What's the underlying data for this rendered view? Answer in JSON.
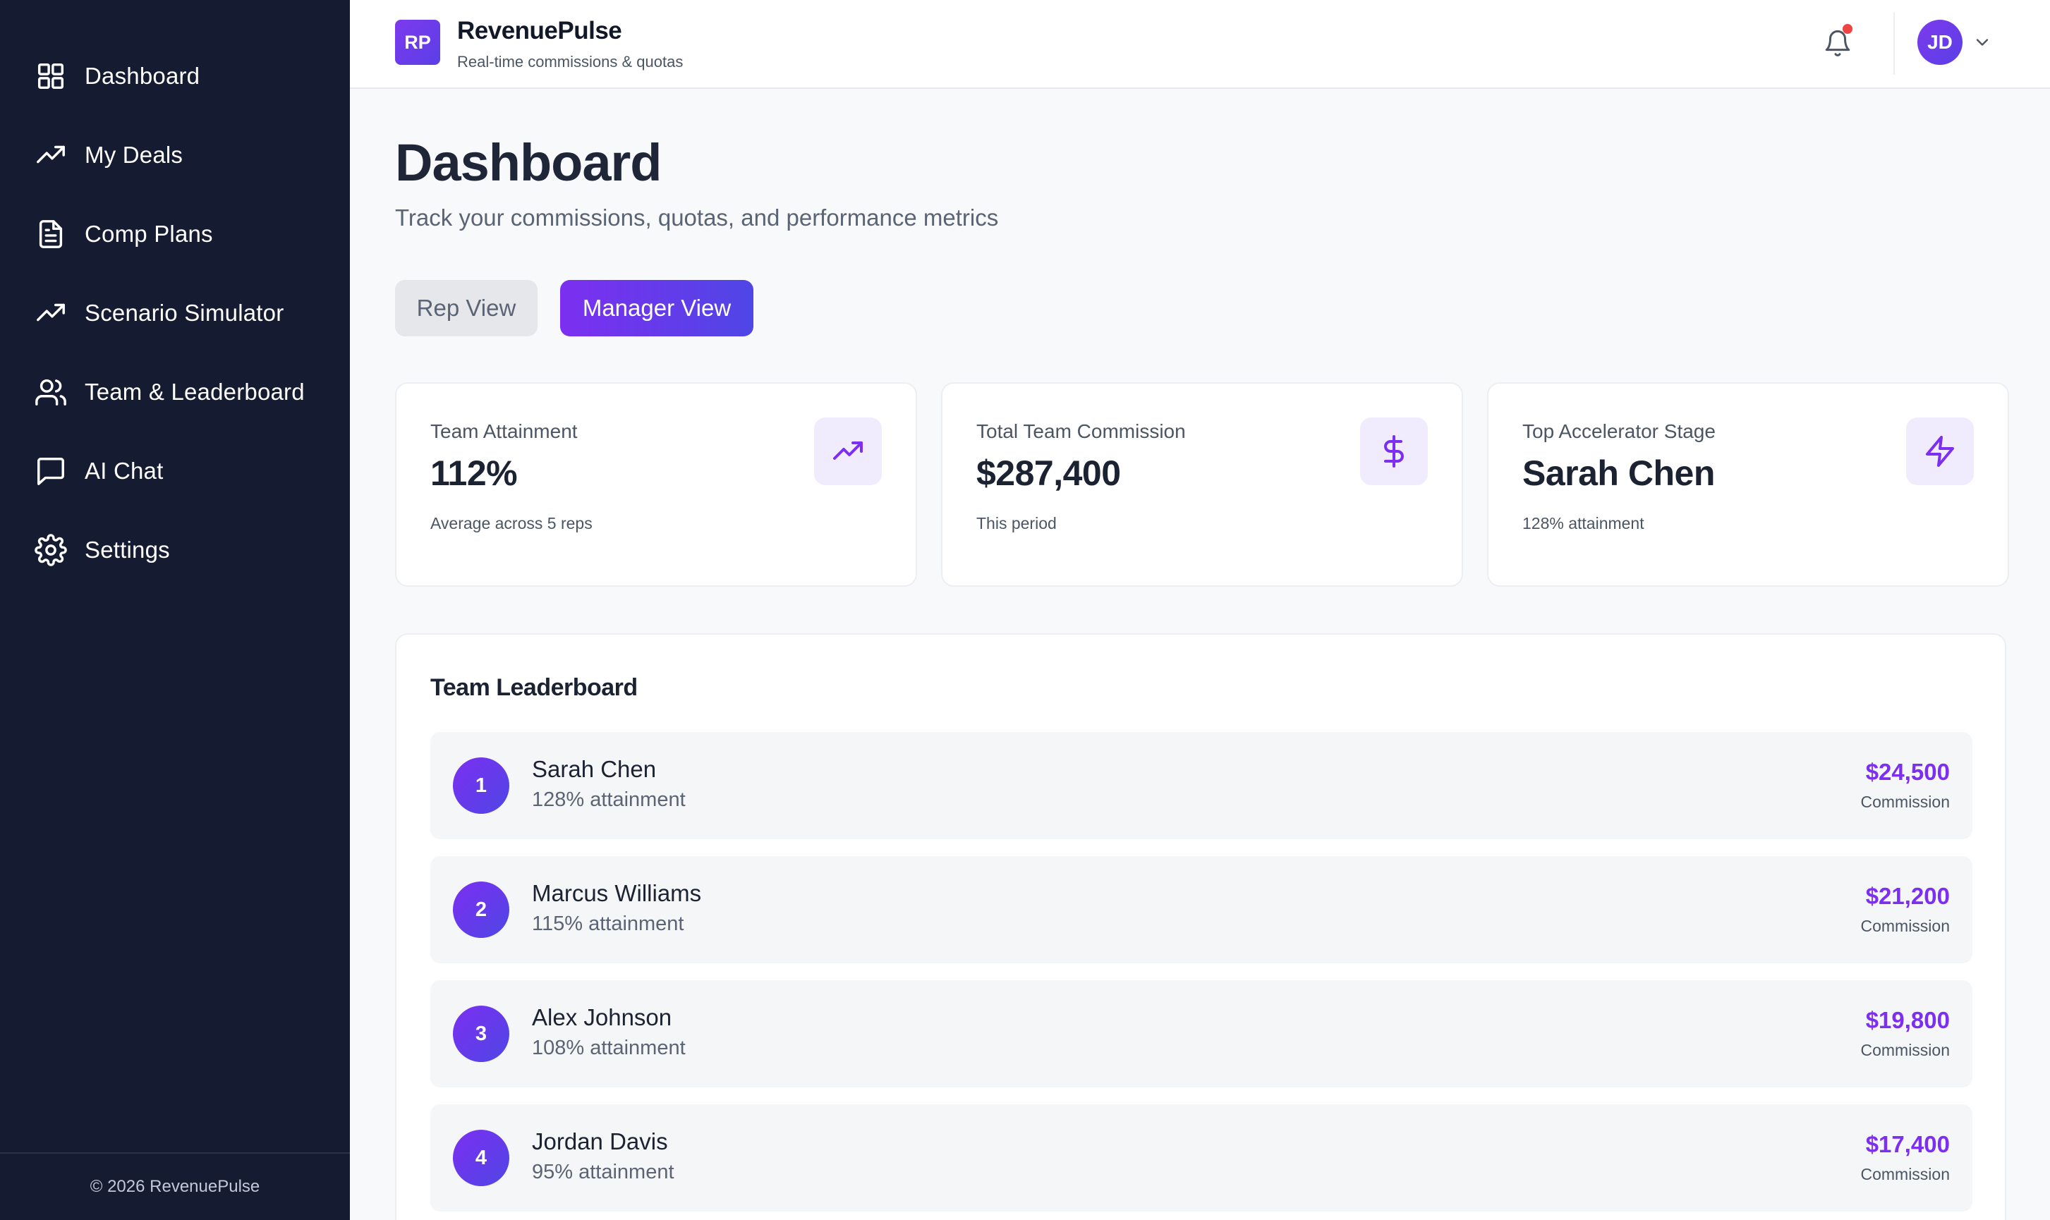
{
  "sidebar": {
    "items": [
      {
        "label": "Dashboard",
        "icon": "grid-icon"
      },
      {
        "label": "My Deals",
        "icon": "trending-up-icon"
      },
      {
        "label": "Comp Plans",
        "icon": "document-icon"
      },
      {
        "label": "Scenario Simulator",
        "icon": "trending-up-icon"
      },
      {
        "label": "Team & Leaderboard",
        "icon": "users-icon"
      },
      {
        "label": "AI Chat",
        "icon": "chat-bubble-icon"
      },
      {
        "label": "Settings",
        "icon": "gear-icon"
      }
    ],
    "footer": "© 2026 RevenuePulse"
  },
  "header": {
    "logo_text": "RP",
    "app_name": "RevenuePulse",
    "tagline": "Real-time commissions & quotas",
    "avatar_initials": "JD",
    "notification_icon": "bell-icon",
    "has_unread": true
  },
  "main": {
    "title": "Dashboard",
    "subtitle": "Track your commissions, quotas, and performance metrics",
    "view_toggle": {
      "rep_label": "Rep View",
      "manager_label": "Manager View",
      "active": "Manager View"
    },
    "stats": [
      {
        "label": "Team Attainment",
        "value": "112%",
        "sub": "Average across 5 reps",
        "icon": "trending-up-icon"
      },
      {
        "label": "Total Team Commission",
        "value": "$287,400",
        "sub": "This period",
        "icon": "dollar-icon"
      },
      {
        "label": "Top Accelerator Stage",
        "value": "Sarah Chen",
        "sub": "128% attainment",
        "icon": "lightning-icon"
      }
    ],
    "leaderboard": {
      "title": "Team Leaderboard",
      "rows": [
        {
          "rank": "1",
          "name": "Sarah Chen",
          "attainment": "128% attainment",
          "commission": "$24,500",
          "commission_label": "Commission"
        },
        {
          "rank": "2",
          "name": "Marcus Williams",
          "attainment": "115% attainment",
          "commission": "$21,200",
          "commission_label": "Commission"
        },
        {
          "rank": "3",
          "name": "Alex Johnson",
          "attainment": "108% attainment",
          "commission": "$19,800",
          "commission_label": "Commission"
        },
        {
          "rank": "4",
          "name": "Jordan Davis",
          "attainment": "95% attainment",
          "commission": "$17,400",
          "commission_label": "Commission"
        }
      ]
    }
  },
  "colors": {
    "sidebar_bg": "#151b31",
    "accent_purple": "#7c2ff0",
    "accent_indigo": "#4f46e5",
    "notification_dot": "#ef4444",
    "page_bg": "#f8f9fb"
  }
}
